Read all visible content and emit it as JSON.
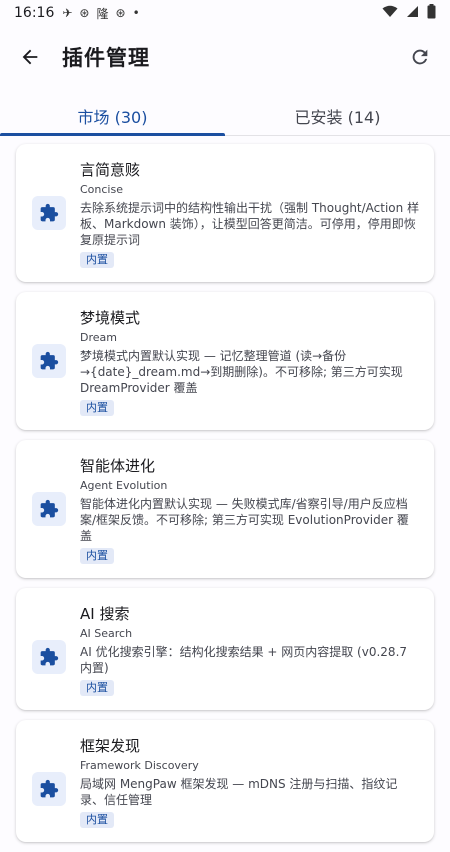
{
  "status": {
    "time": "16:16",
    "icons": [
      "✈",
      "⊛",
      "隆",
      "⊛",
      "•"
    ]
  },
  "header": {
    "title": "插件管理"
  },
  "tabs": [
    {
      "label": "市场 (30)",
      "active": true
    },
    {
      "label": "已安装 (14)",
      "active": false
    }
  ],
  "plugins": [
    {
      "name": "言简意赅",
      "subtitle": "Concise",
      "description": "去除系统提示词中的结构性输出干扰（强制 Thought/Action 样板、Markdown 装饰），让模型回答更简洁。可停用，停用即恢复原提示词",
      "badge": "内置"
    },
    {
      "name": "梦境模式",
      "subtitle": "Dream",
      "description": "梦境模式内置默认实现 — 记忆整理管道 (读→备份→{date}_dream.md→到期删除)。不可移除; 第三方可实现 DreamProvider 覆盖",
      "badge": "内置"
    },
    {
      "name": "智能体进化",
      "subtitle": "Agent Evolution",
      "description": "智能体进化内置默认实现 — 失败模式库/省察引导/用户反应档案/框架反馈。不可移除; 第三方可实现 EvolutionProvider 覆盖",
      "badge": "内置"
    },
    {
      "name": "AI 搜索",
      "subtitle": "AI Search",
      "description": "AI 优化搜索引擎：结构化搜索结果 + 网页内容提取 (v0.28.7 内置)",
      "badge": "内置"
    },
    {
      "name": "框架发现",
      "subtitle": "Framework Discovery",
      "description": "局域网 MengPaw 框架发现 — mDNS 注册与扫描、指纹记录、信任管理",
      "badge": "内置"
    }
  ]
}
